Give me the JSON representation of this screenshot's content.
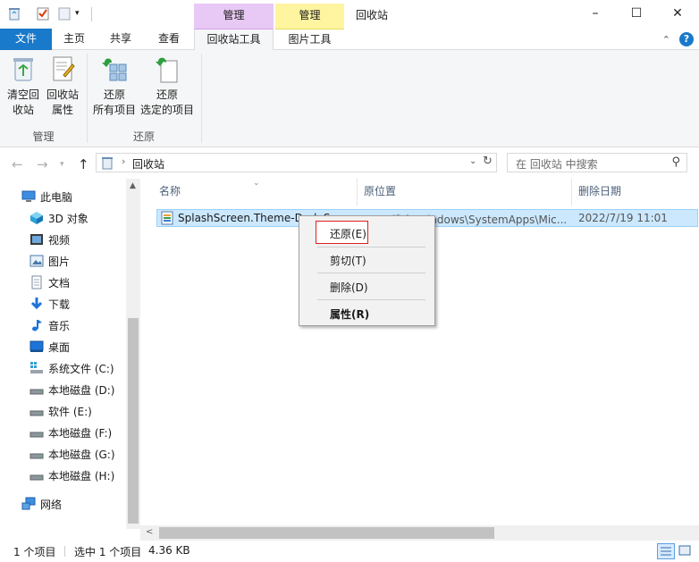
{
  "window": {
    "title": "回收站",
    "context_tab_manage_1": "管理",
    "context_tab_manage_2": "管理",
    "minimize": "–",
    "maximize": "☐",
    "close": "✕"
  },
  "tabs": {
    "file": "文件",
    "home": "主页",
    "share": "共享",
    "view": "查看",
    "recycle_tools": "回收站工具",
    "picture_tools": "图片工具"
  },
  "ribbon": {
    "empty_line1": "清空回",
    "empty_line2": "收站",
    "props_line1": "回收站",
    "props_line2": "属性",
    "restore_all_line1": "还原",
    "restore_all_line2": "所有项目",
    "restore_sel_line1": "还原",
    "restore_sel_line2": "选定的项目",
    "group_manage": "管理",
    "group_restore": "还原"
  },
  "address": {
    "path": "回收站",
    "search_placeholder": "在 回收站 中搜索"
  },
  "nav": {
    "items": [
      {
        "label": "此电脑",
        "icon": "computer-icon"
      },
      {
        "label": "3D 对象",
        "icon": "cube-icon"
      },
      {
        "label": "视频",
        "icon": "video-icon"
      },
      {
        "label": "图片",
        "icon": "picture-icon"
      },
      {
        "label": "文档",
        "icon": "document-icon"
      },
      {
        "label": "下载",
        "icon": "download-icon"
      },
      {
        "label": "音乐",
        "icon": "music-icon"
      },
      {
        "label": "桌面",
        "icon": "desktop-icon"
      },
      {
        "label": "系统文件 (C:)",
        "icon": "system-drive-icon"
      },
      {
        "label": "本地磁盘 (D:)",
        "icon": "drive-icon"
      },
      {
        "label": "软件 (E:)",
        "icon": "drive-icon"
      },
      {
        "label": "本地磁盘 (F:)",
        "icon": "drive-icon"
      },
      {
        "label": "本地磁盘 (G:)",
        "icon": "drive-icon"
      },
      {
        "label": "本地磁盘 (H:)",
        "icon": "drive-icon"
      },
      {
        "label": "网络",
        "icon": "network-icon"
      }
    ]
  },
  "columns": {
    "name": "名称",
    "original_location": "原位置",
    "date_deleted": "删除日期"
  },
  "file": {
    "name": "SplashScreen.Theme-Dark.Scale",
    "location": "D:\\三晚上\\Windows\\SystemApps\\Mic...",
    "date": "2022/7/19 11:01"
  },
  "context_menu": {
    "restore": "还原(E)",
    "cut": "剪切(T)",
    "delete": "删除(D)",
    "properties": "属性(R)"
  },
  "status": {
    "count": "1 个项目",
    "selected": "选中 1 个项目",
    "size": "4.36 KB"
  },
  "colors": {
    "file_tab": "#1979ca",
    "selection": "#cce8ff",
    "manage_purple": "#e8c8f4",
    "manage_yellow": "#fff4a0"
  }
}
